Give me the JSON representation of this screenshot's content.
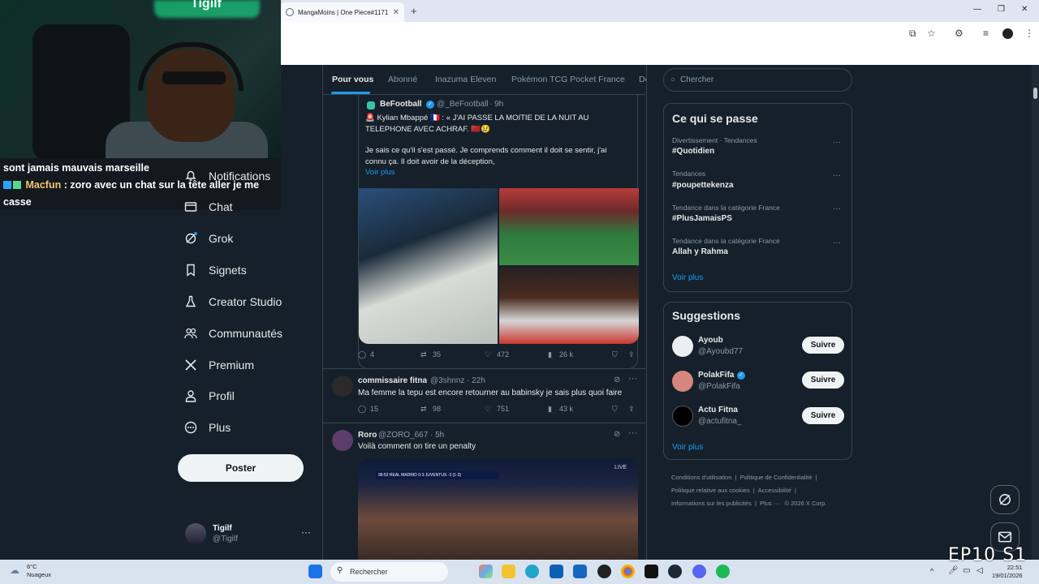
{
  "browser": {
    "tab_title": "MangaMoins | One Piece#1171",
    "tab_close": "✕",
    "new_tab": "+",
    "win_min": "—",
    "win_max": "❐",
    "win_close": "✕"
  },
  "stream": {
    "neon_sign": "Tigilf",
    "chat_line1": "sont jamais mauvais marseille",
    "chat_user": "Macfun",
    "chat_msg": ": zoro avec un chat sur la tête aller je me casse"
  },
  "nav": {
    "items": [
      {
        "label": "Notifications",
        "icon": "bell-icon"
      },
      {
        "label": "Chat",
        "icon": "mail-icon"
      },
      {
        "label": "Grok",
        "icon": "grok-icon"
      },
      {
        "label": "Signets",
        "icon": "bookmark-icon"
      },
      {
        "label": "Creator Studio",
        "icon": "flask-icon"
      },
      {
        "label": "Communautés",
        "icon": "people-icon"
      },
      {
        "label": "Premium",
        "icon": "x-logo-icon"
      },
      {
        "label": "Profil",
        "icon": "person-icon"
      },
      {
        "label": "Plus",
        "icon": "more-circle-icon"
      }
    ],
    "post_button": "Poster",
    "profile": {
      "name": "Tigilf",
      "handle": "@Tigilf",
      "more": "···"
    }
  },
  "timeline": {
    "tabs": [
      "Pour vous",
      "Abonné",
      "Inazuma Eleven",
      "Pokémon TCG Pocket France",
      "Dé"
    ],
    "quoted": {
      "author": "BeFootball",
      "handle": "@_BeFootball",
      "time": "· 9h",
      "line1": "🚨 Kylian Mbappé 🇫🇷 : « J'AI PASSE LA MOITIE DE LA NUIT AU",
      "line2": "TELEPHONE AVEC ACHRAF. 🇲🇦😢",
      "line3": "Je sais ce qu'il s'est passé. Je comprends comment il doit se sentir, j'ai",
      "line4": "connu ça. Il doit avoir de la déception,",
      "see_more": "Voir plus",
      "replies": "4",
      "reposts": "35",
      "likes": "472",
      "views": "26 k"
    },
    "post2": {
      "author": "commissaire fitna",
      "handle": "@3shnnz",
      "time": "· 22h",
      "text": "Ma femme la tepu est encore retourner au babinsky je sais plus quoi faire",
      "replies": "15",
      "reposts": "98",
      "likes": "751",
      "views": "43 k"
    },
    "post3": {
      "author": "Roro",
      "handle": "@ZORO_667",
      "time": "· 5h",
      "text": "Voilà comment on tire un penalty",
      "video_badge": "LIVE",
      "scoreboard": "96:52  REAL MADRID  0-3  JUVENTUS  ·3  (1-3)"
    }
  },
  "right": {
    "search_placeholder": "Chercher",
    "trends_title": "Ce qui se passe",
    "trends": [
      {
        "meta": "Divertissement · Tendances",
        "name": "#Quotidien"
      },
      {
        "meta": "Tendances",
        "name": "#poupettekenza"
      },
      {
        "meta": "Tendance dans la catégorie France",
        "name": "#PlusJamaisPS"
      },
      {
        "meta": "Tendance dans la catégorie France",
        "name": "Allah y Rahma"
      }
    ],
    "trends_more": "Voir plus",
    "suggest_title": "Suggestions",
    "suggestions": [
      {
        "name": "Ayoub",
        "handle": "@Ayoubd77",
        "button": "Suivre",
        "verified": false
      },
      {
        "name": "PolakFifa",
        "handle": "@PolakFifa",
        "button": "Suivre",
        "verified": true
      },
      {
        "name": "Actu Fitna",
        "handle": "@actufitna_",
        "button": "Suivre",
        "verified": false
      }
    ],
    "suggest_more": "Voir plus",
    "footer": {
      "l1": "Conditions d'utilisation",
      "l2": "Politique de Confidentialité",
      "l3": "Politique relative aux cookies",
      "l4": "Accessibilité",
      "l5": "Informations sur les publicités",
      "l6": "Plus ···",
      "l7": "© 2026 X Corp."
    }
  },
  "taskbar": {
    "temp": "6°C",
    "weather": "Nuageux",
    "search": "Rechercher",
    "time": "22:51",
    "date": "19/01/2026"
  },
  "watermark": "EP10 S1",
  "colors": {
    "accent": "#1d9bf0",
    "bg": "#15202b",
    "border": "#38444d"
  }
}
